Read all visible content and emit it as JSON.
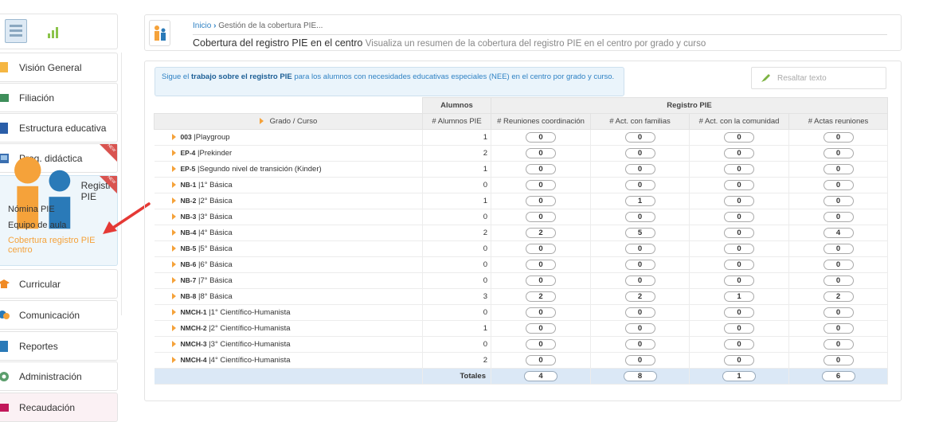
{
  "sidebar": {
    "items": [
      {
        "label": "Visión General"
      },
      {
        "label": "Filiación"
      },
      {
        "label": "Estructura educativa"
      },
      {
        "label": "Prog. didáctica",
        "badge": "NEW"
      },
      {
        "label": "Registro PIE",
        "badge": "NEW",
        "subitems": [
          "Nómina PIE",
          "Equipo de aula",
          "Cobertura registro PIE centro"
        ]
      },
      {
        "label": "Curricular"
      },
      {
        "label": "Comunicación"
      },
      {
        "label": "Reportes"
      },
      {
        "label": "Administración"
      },
      {
        "label": "Recaudación"
      }
    ]
  },
  "header": {
    "breadcrumb_home": "Inicio",
    "breadcrumb_current": "Gestión de la cobertura PIE...",
    "title": "Cobertura del registro PIE en el centro",
    "description": "Visualiza un resumen de la cobertura del registro PIE en el centro por grado y curso"
  },
  "notice": {
    "prefix": "Sigue el ",
    "link": "trabajo sobre el registro PIE",
    "suffix": " para los alumnos con necesidades educativas especiales (NEE) en el centro por grado y curso."
  },
  "highlight": {
    "label": "Resaltar texto"
  },
  "table": {
    "group_alumnos": "Alumnos",
    "group_registro": "Registro PIE",
    "col_grado": "Grado / Curso",
    "col_alumnos": "# Alumnos PIE",
    "col_reuniones": "# Reuniones coordinación",
    "col_familias": "# Act. con familias",
    "col_comunidad": "# Act. con la comunidad",
    "col_actas": "# Actas reuniones",
    "rows": [
      {
        "code": "003",
        "name": "Playgroup",
        "alumnos": "1",
        "reuniones": "0",
        "familias": "0",
        "comunidad": "0",
        "actas": "0"
      },
      {
        "code": "EP-4",
        "name": "Prekinder",
        "alumnos": "2",
        "reuniones": "0",
        "familias": "0",
        "comunidad": "0",
        "actas": "0"
      },
      {
        "code": "EP-5",
        "name": "Segundo nivel de transición (Kinder)",
        "alumnos": "1",
        "reuniones": "0",
        "familias": "0",
        "comunidad": "0",
        "actas": "0"
      },
      {
        "code": "NB-1",
        "name": "1° Básica",
        "alumnos": "0",
        "reuniones": "0",
        "familias": "0",
        "comunidad": "0",
        "actas": "0"
      },
      {
        "code": "NB-2",
        "name": "2° Básica",
        "alumnos": "1",
        "reuniones": "0",
        "familias": "1",
        "comunidad": "0",
        "actas": "0"
      },
      {
        "code": "NB-3",
        "name": "3° Básica",
        "alumnos": "0",
        "reuniones": "0",
        "familias": "0",
        "comunidad": "0",
        "actas": "0"
      },
      {
        "code": "NB-4",
        "name": "4° Básica",
        "alumnos": "2",
        "reuniones": "2",
        "familias": "5",
        "comunidad": "0",
        "actas": "4"
      },
      {
        "code": "NB-5",
        "name": "5° Básica",
        "alumnos": "0",
        "reuniones": "0",
        "familias": "0",
        "comunidad": "0",
        "actas": "0"
      },
      {
        "code": "NB-6",
        "name": "6° Básica",
        "alumnos": "0",
        "reuniones": "0",
        "familias": "0",
        "comunidad": "0",
        "actas": "0"
      },
      {
        "code": "NB-7",
        "name": "7° Básica",
        "alumnos": "0",
        "reuniones": "0",
        "familias": "0",
        "comunidad": "0",
        "actas": "0"
      },
      {
        "code": "NB-8",
        "name": "8° Básica",
        "alumnos": "3",
        "reuniones": "2",
        "familias": "2",
        "comunidad": "1",
        "actas": "2"
      },
      {
        "code": "NMCH-1",
        "name": "1° Científico-Humanista",
        "alumnos": "0",
        "reuniones": "0",
        "familias": "0",
        "comunidad": "0",
        "actas": "0"
      },
      {
        "code": "NMCH-2",
        "name": "2° Científico-Humanista",
        "alumnos": "1",
        "reuniones": "0",
        "familias": "0",
        "comunidad": "0",
        "actas": "0"
      },
      {
        "code": "NMCH-3",
        "name": "3° Científico-Humanista",
        "alumnos": "0",
        "reuniones": "0",
        "familias": "0",
        "comunidad": "0",
        "actas": "0"
      },
      {
        "code": "NMCH-4",
        "name": "4° Científico-Humanista",
        "alumnos": "2",
        "reuniones": "0",
        "familias": "0",
        "comunidad": "0",
        "actas": "0"
      }
    ],
    "totals": {
      "label": "Totales",
      "reuniones": "4",
      "familias": "8",
      "comunidad": "1",
      "actas": "6"
    }
  },
  "colors": {
    "accent": "#2f82c4",
    "active": "#f5a23a",
    "arrow": "#e53935",
    "badge": "#d9534f"
  }
}
